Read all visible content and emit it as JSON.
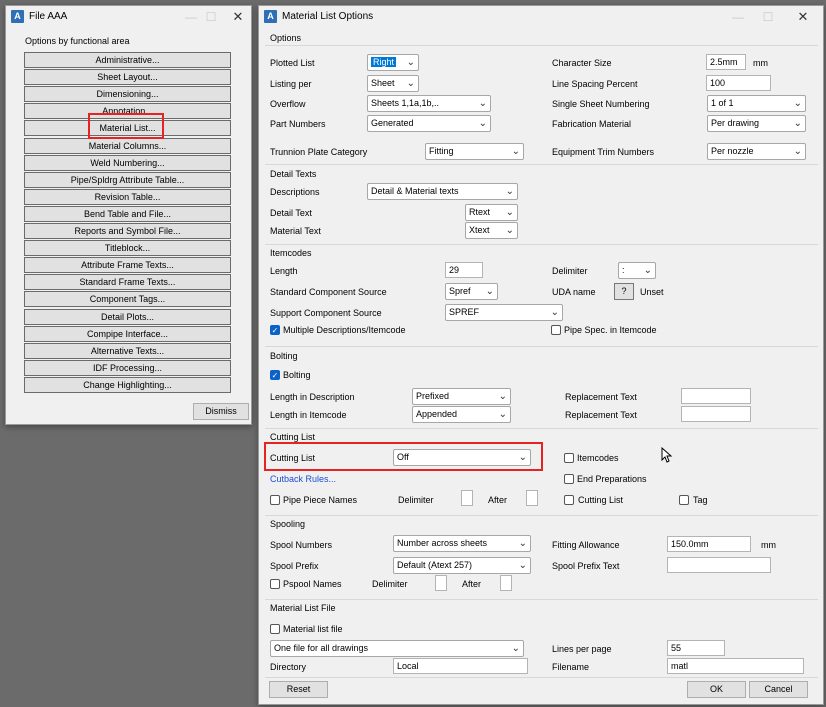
{
  "left_window": {
    "title": "File AAA",
    "heading": "Options by functional area",
    "buttons": [
      "Administrative...",
      "Sheet Layout...",
      "Dimensioning...",
      "Annotation...",
      "Material List...",
      "Material Columns...",
      "Weld Numbering...",
      "Pipe/Spldrg Attribute Table...",
      "Revision Table...",
      "Bend Table and File...",
      "Reports and Symbol File...",
      "Titleblock...",
      "Attribute Frame Texts...",
      "Standard Frame Texts...",
      "Component Tags...",
      "Detail Plots...",
      "Compipe Interface...",
      "Alternative Texts...",
      "IDF Processing...",
      "Change Highlighting..."
    ],
    "dismiss": "Dismiss"
  },
  "dialog": {
    "title": "Material List Options",
    "options": {
      "title": "Options",
      "plotted_list_label": "Plotted List",
      "plotted_list_value": "Right",
      "listing_per_label": "Listing per",
      "listing_per_value": "Sheet",
      "overflow_label": "Overflow",
      "overflow_value": "Sheets 1,1a,1b,..",
      "part_numbers_label": "Part Numbers",
      "part_numbers_value": "Generated",
      "trunnion_label": "Trunnion Plate Category",
      "trunnion_value": "Fitting",
      "char_size_label": "Character Size",
      "char_size_value": "2.5mm",
      "char_size_unit": "mm",
      "line_spacing_label": "Line Spacing Percent",
      "line_spacing_value": "100",
      "single_sheet_label": "Single Sheet Numbering",
      "single_sheet_value": "1 of 1",
      "fab_material_label": "Fabrication Material",
      "fab_material_value": "Per drawing",
      "equip_trim_label": "Equipment Trim Numbers",
      "equip_trim_value": "Per nozzle"
    },
    "detail_texts": {
      "title": "Detail Texts",
      "descriptions_label": "Descriptions",
      "descriptions_value": "Detail & Material texts",
      "detail_text_label": "Detail Text",
      "detail_text_value": "Rtext",
      "material_text_label": "Material Text",
      "material_text_value": "Xtext"
    },
    "itemcodes": {
      "title": "Itemcodes",
      "length_label": "Length",
      "length_value": "29",
      "std_source_label": "Standard Component Source",
      "std_source_value": "Spref",
      "support_source_label": "Support Component Source",
      "support_source_value": "SPREF",
      "multiple_desc_label": "Multiple Descriptions/Itemcode",
      "delimiter_label": "Delimiter",
      "delimiter_value": ":",
      "uda_label": "UDA name",
      "uda_button": "?",
      "uda_value": "Unset",
      "pipe_spec_label": "Pipe Spec. in Itemcode"
    },
    "bolting": {
      "title": "Bolting",
      "bolting_label": "Bolting",
      "len_desc_label": "Length in Description",
      "len_desc_value": "Prefixed",
      "len_item_label": "Length in Itemcode",
      "len_item_value": "Appended",
      "replacement_label_1": "Replacement Text",
      "replacement_label_2": "Replacement Text"
    },
    "cutting_list": {
      "title": "Cutting List",
      "cutting_list_label": "Cutting List",
      "cutting_list_value": "Off",
      "cutback_link": "Cutback Rules...",
      "pipe_piece_label": "Pipe Piece Names",
      "delimiter_label": "Delimiter",
      "after_label": "After",
      "itemcodes_label": "Itemcodes",
      "end_prep_label": "End Preparations",
      "cutting_list_chk_label": "Cutting List",
      "tag_label": "Tag"
    },
    "spooling": {
      "title": "Spooling",
      "spool_numbers_label": "Spool Numbers",
      "spool_numbers_value": "Number across sheets",
      "spool_prefix_label": "Spool Prefix",
      "spool_prefix_value": "Default (Atext 257)",
      "pspool_label": "Pspool Names",
      "delimiter_label": "Delimiter",
      "after_label": "After",
      "fitting_allowance_label": "Fitting Allowance",
      "fitting_allowance_value": "150.0mm",
      "fitting_allowance_unit": "mm",
      "spool_prefix_text_label": "Spool Prefix Text"
    },
    "material_file": {
      "title": "Material List File",
      "material_file_label": "Material list file",
      "file_mode_value": "One file for all drawings",
      "directory_label": "Directory",
      "directory_value": "Local",
      "lines_per_page_label": "Lines per page",
      "lines_per_page_value": "55",
      "filename_label": "Filename",
      "filename_value": "matl"
    },
    "reset": "Reset",
    "ok": "OK",
    "cancel": "Cancel"
  }
}
